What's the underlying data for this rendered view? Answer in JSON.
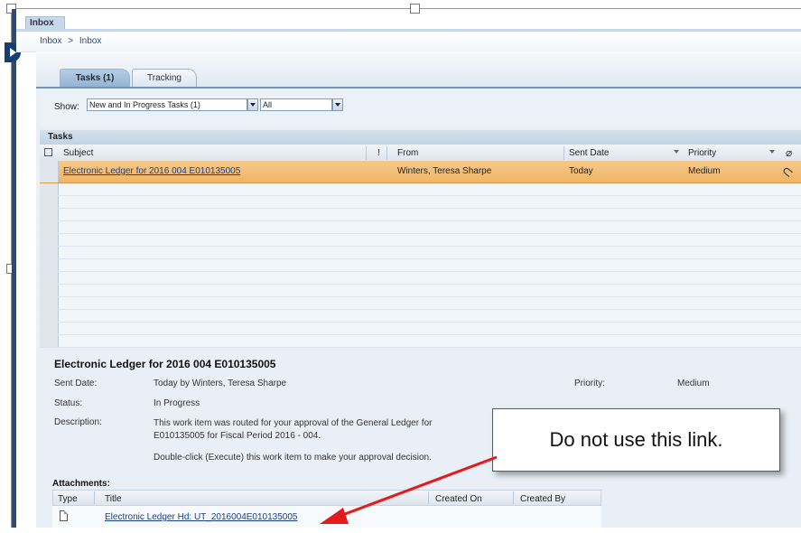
{
  "window": {
    "inbox_tab": "Inbox"
  },
  "breadcrumb": {
    "root": "Inbox",
    "separator": ">",
    "current": "Inbox"
  },
  "tabs": [
    {
      "label": "Tasks (1)",
      "active": true
    },
    {
      "label": "Tracking",
      "active": false
    }
  ],
  "filter": {
    "show_label": "Show:",
    "task_filter": "New and In Progress Tasks (1)",
    "scope_filter": "All"
  },
  "tasks": {
    "title": "Tasks",
    "columns": {
      "subject": "Subject",
      "flag": "!",
      "from": "From",
      "sent_date": "Sent Date",
      "priority": "Priority"
    },
    "rows": [
      {
        "subject": "Electronic Ledger for 2016 004 E010135005",
        "from": "Winters, Teresa Sharpe",
        "sent_date": "Today",
        "priority": "Medium",
        "has_attachment": true
      }
    ]
  },
  "details": {
    "title": "Electronic Ledger for 2016 004 E010135005",
    "sent_date_label": "Sent Date:",
    "sent_date_value": "Today by Winters, Teresa Sharpe",
    "priority_label": "Priority:",
    "priority_value": "Medium",
    "status_label": "Status:",
    "status_value": "In Progress",
    "description_label": "Description:",
    "description_line1": "This work item was routed for your approval of the General Ledger for E010135005 for Fiscal Period 2016 - 004.",
    "description_line2": "Double-click (Execute) this work item to make your approval decision."
  },
  "attachments": {
    "label": "Attachments:",
    "columns": {
      "type": "Type",
      "title": "Title",
      "created_on": "Created On",
      "created_by": "Created By"
    },
    "rows": [
      {
        "title": "Electronic Ledger Hd: UT_2016004E010135005",
        "icon": "document-icon"
      }
    ]
  },
  "callout": {
    "text": "Do not use this link."
  },
  "colors": {
    "selected_row": "#f0b466",
    "link": "#1b3f8a",
    "arrow": "#e31b1b",
    "nav": "#17406e"
  }
}
